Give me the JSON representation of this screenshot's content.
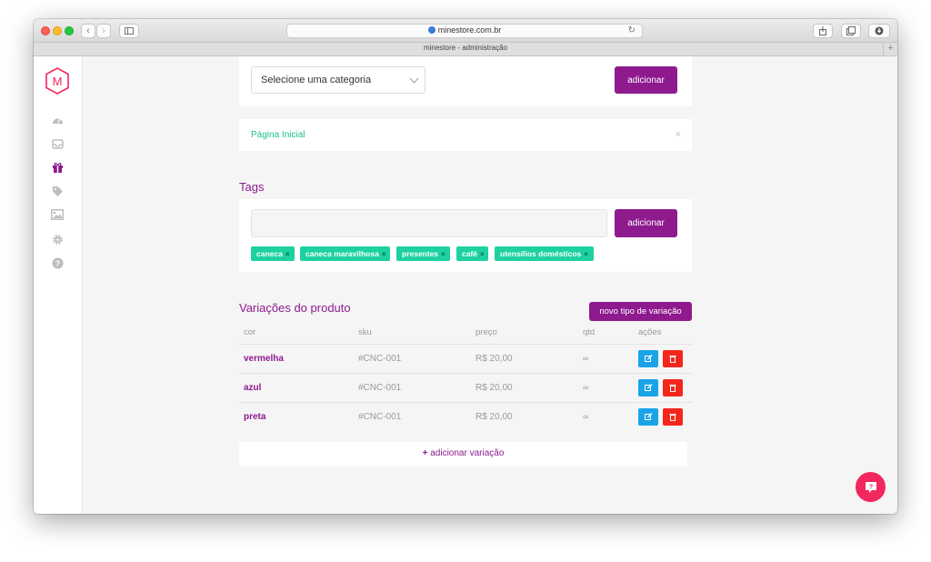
{
  "browser": {
    "url": "minestore.com.br",
    "tab_title": "minestore - administração"
  },
  "colors": {
    "accent": "#8e1a8e",
    "tag": "#1dd1a1",
    "edit": "#1aa3e8",
    "delete": "#f4271d",
    "help": "#f2275d",
    "link_green": "#1dbf8f"
  },
  "sidebar": {
    "logo_letter": "M",
    "items": [
      {
        "icon": "dashboard-icon"
      },
      {
        "icon": "inbox-icon"
      },
      {
        "icon": "gift-icon",
        "active": true
      },
      {
        "icon": "tag-icon"
      },
      {
        "icon": "image-icon"
      },
      {
        "icon": "gear-icon"
      },
      {
        "icon": "help-icon"
      }
    ]
  },
  "category": {
    "select_value": "Selecione uma categoria",
    "add_label": "adicionar",
    "selected_item": "Página Inicial",
    "remove_symbol": "×"
  },
  "tags": {
    "title": "Tags",
    "input_value": "",
    "add_label": "adicionar",
    "remove_symbol": "×",
    "items": [
      "caneca",
      "caneca maravilhosa",
      "presentes",
      "café",
      "utensílios domésticos"
    ]
  },
  "variations": {
    "title": "Variações do produto",
    "new_type_label": "novo tipo de variação",
    "headers": [
      "cor",
      "sku",
      "preço",
      "qtd",
      "ações"
    ],
    "rows": [
      {
        "cor": "vermelha",
        "sku": "#CNC-001",
        "preco": "R$ 20,00",
        "qtd": "∞"
      },
      {
        "cor": "azul",
        "sku": "#CNC-001",
        "preco": "R$ 20,00",
        "qtd": "∞"
      },
      {
        "cor": "preta",
        "sku": "#CNC-001",
        "preco": "R$ 20,00",
        "qtd": "∞"
      }
    ],
    "add_symbol": "+",
    "add_label": "adicionar variação"
  }
}
